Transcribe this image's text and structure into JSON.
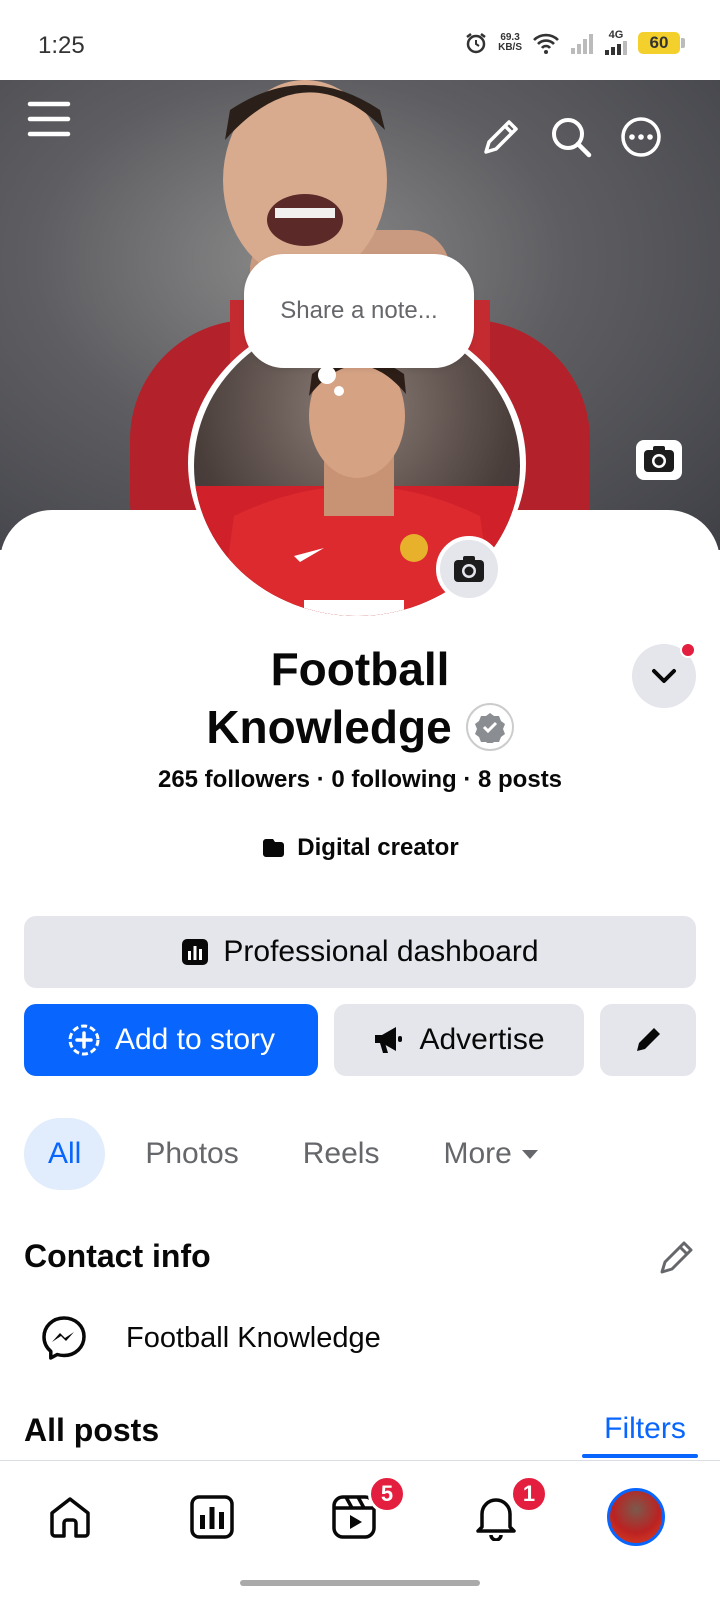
{
  "status_bar": {
    "time": "1:25",
    "speed_value": "69.3",
    "speed_unit": "KB/S",
    "network": "4G",
    "battery": "60"
  },
  "cover": {
    "note_placeholder": "Share a note..."
  },
  "profile": {
    "name_line1": "Football",
    "name_line2": "Knowledge",
    "stats": "265 followers · 0 following · 8 posts",
    "category": "Digital creator"
  },
  "actions": {
    "dashboard": "Professional dashboard",
    "add_to_story": "Add to story",
    "advertise": "Advertise"
  },
  "tabs": [
    {
      "label": "All"
    },
    {
      "label": "Photos"
    },
    {
      "label": "Reels"
    },
    {
      "label": "More"
    }
  ],
  "contact": {
    "title": "Contact info",
    "messenger_name": "Football Knowledge"
  },
  "posts": {
    "title": "All posts",
    "filters": "Filters"
  },
  "nav": {
    "reels_badge": "5",
    "notifications_badge": "1"
  },
  "colors": {
    "primary": "#0866ff",
    "badge": "#e41e3f",
    "surface": "#e4e6eb"
  }
}
